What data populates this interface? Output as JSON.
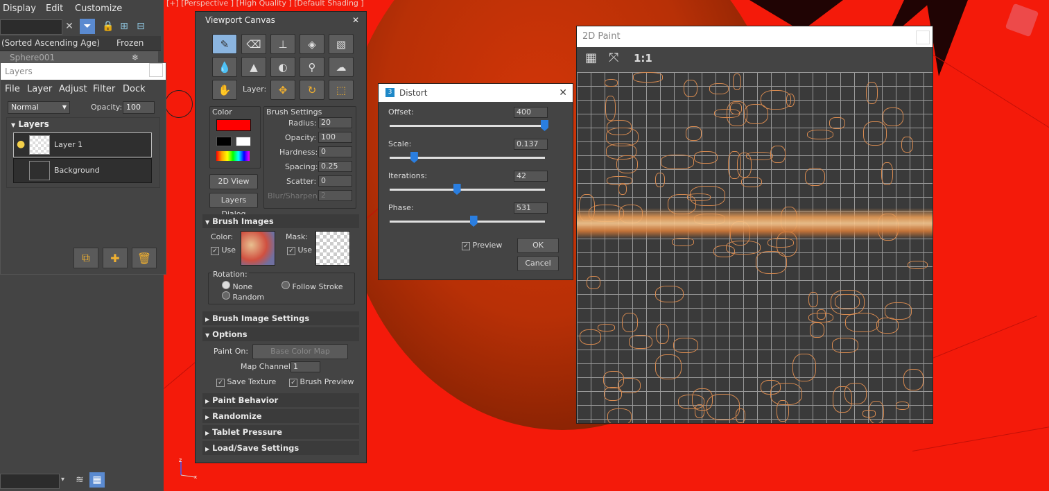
{
  "left_panel": {
    "menu": [
      "Display",
      "Edit",
      "Customize"
    ],
    "columns": {
      "name": "(Sorted Ascending Age)",
      "frozen": "Frozen"
    },
    "scene_row": "Sphere001"
  },
  "layers_window": {
    "title": "Layers",
    "menu": [
      "File",
      "Layer",
      "Adjust",
      "Filter",
      "Dock"
    ],
    "blend_mode": "Normal",
    "opacity_label": "Opacity:",
    "opacity_value": "100",
    "section_title": "Layers",
    "layers": [
      "Layer 1",
      "Background"
    ]
  },
  "viewport": {
    "label": "[+] [Perspective ] [High Quality ] [Default Shading ]",
    "background_color": "#f41a0a"
  },
  "viewport_canvas": {
    "title": "Viewport Canvas",
    "layer_label": "Layer:",
    "color_label": "Color",
    "primary_color": "#ff0000",
    "brush_settings_label": "Brush Settings",
    "brush_settings": [
      {
        "label": "Radius:",
        "value": "20"
      },
      {
        "label": "Opacity:",
        "value": "100"
      },
      {
        "label": "Hardness:",
        "value": "0"
      },
      {
        "label": "Spacing:",
        "value": "0.25"
      },
      {
        "label": "Scatter:",
        "value": "0"
      },
      {
        "label": "Blur/Sharpen:",
        "value": "2"
      }
    ],
    "view_2d_button": "2D View",
    "layers_dialog_button": "Layers Dialog",
    "brush_images": {
      "title": "Brush Images",
      "color_label": "Color:",
      "mask_label": "Mask:",
      "use_label": "Use",
      "rotation_label": "Rotation:",
      "rotation_options": [
        "None",
        "Follow Stroke",
        "Random"
      ]
    },
    "rollouts_collapsed_1": "Brush Image Settings",
    "options": {
      "title": "Options",
      "paint_on_label": "Paint On:",
      "paint_on_value": "Base Color Map",
      "map_channel_label": "Map Channel:",
      "map_channel_value": "1",
      "save_texture": "Save Texture",
      "brush_preview": "Brush Preview"
    },
    "rollouts_collapsed": [
      "Paint Behavior",
      "Randomize",
      "Tablet Pressure",
      "Load/Save Settings"
    ]
  },
  "distort_dialog": {
    "title": "Distort",
    "params": [
      {
        "label": "Offset:",
        "value": "400",
        "position": 1.0
      },
      {
        "label": "Scale:",
        "value": "0.137",
        "position": 0.137
      },
      {
        "label": "Iterations:",
        "value": "42",
        "position": 0.42
      },
      {
        "label": "Phase:",
        "value": "531",
        "position": 0.53
      }
    ],
    "preview_label": "Preview",
    "ok_button": "OK",
    "cancel_button": "Cancel"
  },
  "paint_2d": {
    "title": "2D Paint",
    "zoom_label": "1:1"
  }
}
